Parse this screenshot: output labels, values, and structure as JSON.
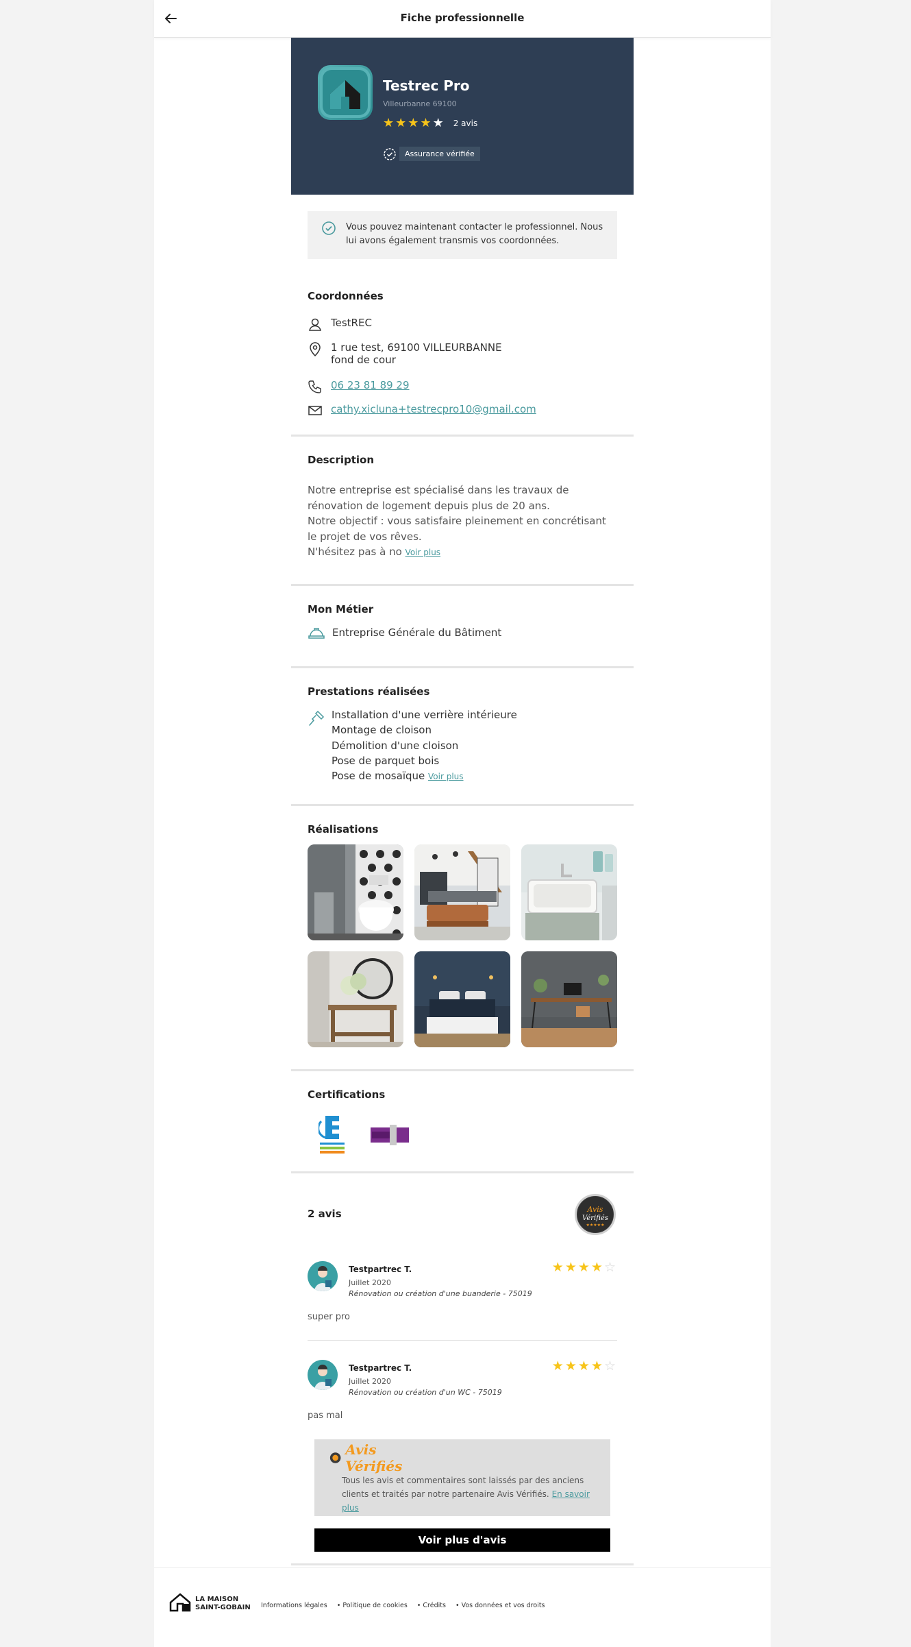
{
  "header": {
    "title": "Fiche professionnelle"
  },
  "pro": {
    "name": "Testrec Pro",
    "city": "Villeurbanne 69100",
    "rating": 4,
    "rating_max": 5,
    "reviews_count": "2 avis",
    "insurance_badge": "Assurance vérifiée"
  },
  "info_box": {
    "text": "Vous pouvez maintenant contacter le professionnel. Nous lui avons également transmis vos coordonnées."
  },
  "contact": {
    "title": "Coordonnées",
    "name": "TestREC",
    "address_line1": "1 rue test, 69100 VILLEURBANNE",
    "address_line2": "fond de cour",
    "phone": "06 23 81 89 29",
    "email": "cathy.xicluna+testrecpro10@gmail.com"
  },
  "description": {
    "title": "Description",
    "line1": "Notre entreprise est spécialisé dans les travaux de rénovation de logement depuis plus de 20 ans.",
    "line2": "Notre objectif : vous satisfaire pleinement en concrétisant le projet de vos rêves.",
    "line3": "N'hésitez pas à no",
    "more": "Voir plus"
  },
  "job": {
    "title": "Mon Métier",
    "value": "Entreprise Générale du Bâtiment"
  },
  "services": {
    "title": "Prestations réalisées",
    "items": [
      "Installation d'une verrière intérieure",
      "Montage de cloison",
      "Démolition d'une cloison",
      "Pose de parquet bois",
      "Pose de mosaïque"
    ],
    "more": "Voir plus"
  },
  "gallery": {
    "title": "Réalisations"
  },
  "certifications": {
    "title": "Certifications",
    "items": [
      "QUALIFELEC",
      "QualiPac"
    ]
  },
  "reviews": {
    "title": "2 avis",
    "items": [
      {
        "author": "Testpartrec T.",
        "date": "Juillet 2020",
        "project": "Rénovation ou création d'une buanderie - 75019",
        "rating": 4,
        "text": "super pro"
      },
      {
        "author": "Testpartrec T.",
        "date": "Juillet 2020",
        "project": "Rénovation ou création d'un WC - 75019",
        "rating": 4,
        "text": "pas mal"
      }
    ],
    "av_brand": "Avis Vérifiés",
    "av_note": "Tous les avis et commentaires sont laissés par des anciens clients et traités par notre partenaire Avis Vérifiés.",
    "av_link": "En savoir plus",
    "more_button": "Voir plus d'avis"
  },
  "footer": {
    "brand_line1": "LA MAISON",
    "brand_line2": "SAINT-GOBAIN",
    "links": [
      "Informations légales",
      "• Politique de cookies",
      "• Crédits",
      "• Vos données et vos droits"
    ]
  },
  "colors": {
    "hero_bg": "#2e3e54",
    "accent": "#4a9a9e",
    "star": "#f7c41a",
    "button": "#000000"
  }
}
